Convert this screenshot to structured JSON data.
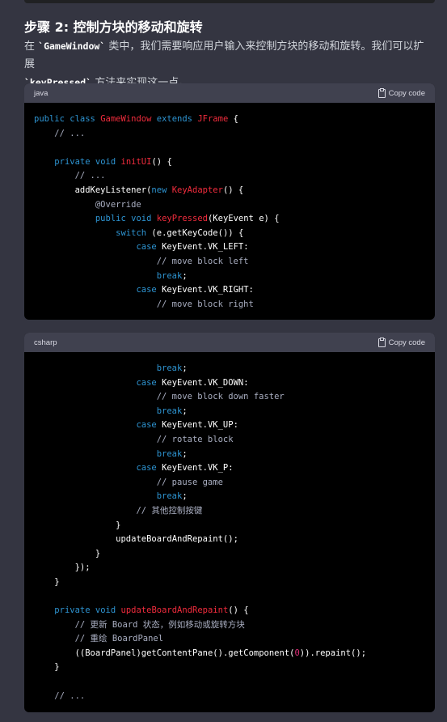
{
  "heading": "步骤 2: 控制方块的移动和旋转",
  "paragraph": {
    "text1": "在 ",
    "code1": "`GameWindow`",
    "text2": " 类中，我们需要响应用户输入来控制方块的移动和旋转。我们可以扩展 ",
    "code2": "`keyPressed`",
    "text3": " 方法来实现这一点。"
  },
  "code_blocks": [
    {
      "language": "java",
      "copy_label": "Copy code",
      "lines": [
        "public class GameWindow extends JFrame {",
        "    // ...",
        "",
        "    private void initUI() {",
        "        // ...",
        "        addKeyListener(new KeyAdapter() {",
        "            @Override",
        "            public void keyPressed(KeyEvent e) {",
        "                switch (e.getKeyCode()) {",
        "                    case KeyEvent.VK_LEFT:",
        "                        // move block left",
        "                        break;",
        "                    case KeyEvent.VK_RIGHT:",
        "                        // move block right"
      ]
    },
    {
      "language": "csharp",
      "copy_label": "Copy code",
      "lines": [
        "                        break;",
        "                    case KeyEvent.VK_DOWN:",
        "                        // move block down faster",
        "                        break;",
        "                    case KeyEvent.VK_UP:",
        "                        // rotate block",
        "                        break;",
        "                    case KeyEvent.VK_P:",
        "                        // pause game",
        "                        break;",
        "                    // 其他控制按键",
        "                }",
        "                updateBoardAndRepaint();",
        "            }",
        "        });",
        "    }",
        "",
        "    private void updateBoardAndRepaint() {",
        "        // 更新 Board 状态，例如移动或旋转方块",
        "        // 重绘 BoardPanel",
        "        ((BoardPanel)getContentPane().getComponent(0)).repaint();",
        "    }",
        "",
        "    // ..."
      ]
    }
  ],
  "colors": {
    "background": "#343541",
    "code_bg": "#000000",
    "keyword": "#2e95d3",
    "type": "#f22c3d",
    "comment": "#a9aec1",
    "number": "#df3079"
  }
}
